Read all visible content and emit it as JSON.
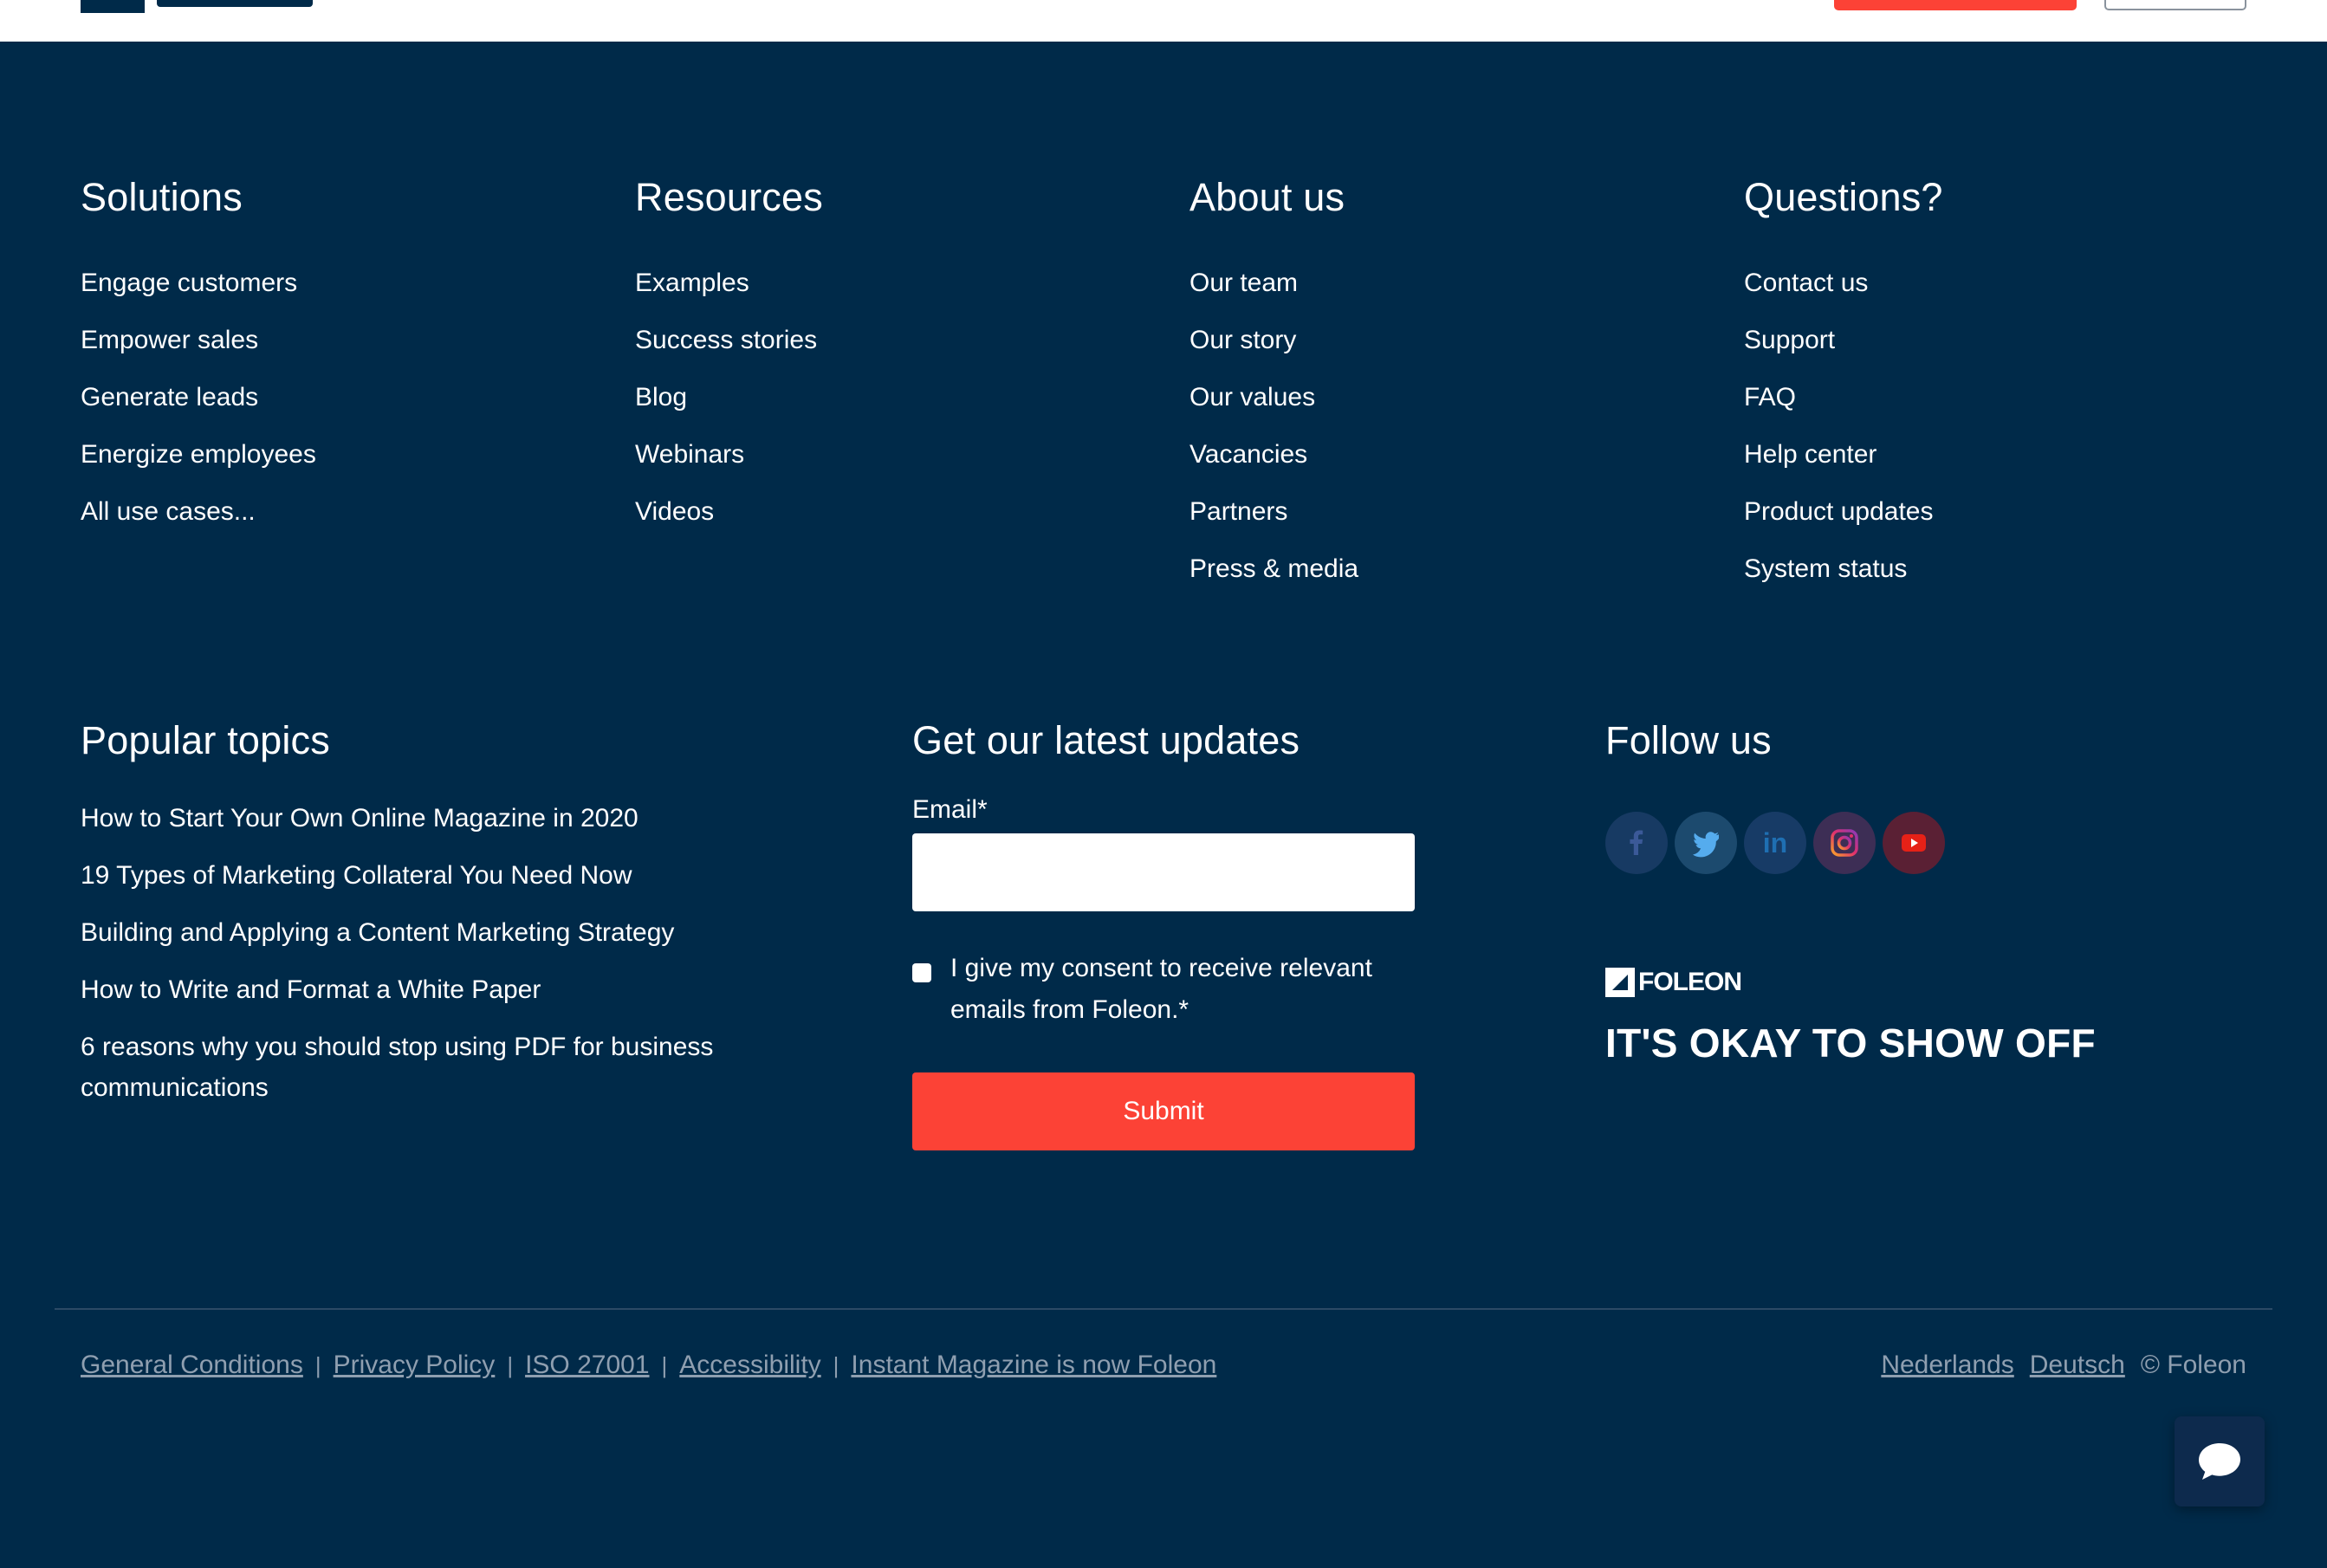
{
  "header": {
    "logo_alt": "Foleon"
  },
  "columns": [
    {
      "title": "Solutions",
      "items": [
        "Engage customers",
        "Empower sales",
        "Generate leads",
        "Energize employees",
        "All use cases..."
      ]
    },
    {
      "title": "Resources",
      "items": [
        "Examples",
        "Success stories",
        "Blog",
        "Webinars",
        "Videos"
      ]
    },
    {
      "title": "About us",
      "items": [
        "Our team",
        "Our story",
        "Our values",
        "Vacancies",
        "Partners",
        "Press & media"
      ]
    },
    {
      "title": "Questions?",
      "items": [
        "Contact us",
        "Support",
        "FAQ",
        "Help center",
        "Product updates",
        "System status"
      ]
    }
  ],
  "popular_topics": {
    "title": "Popular topics",
    "items": [
      "How to Start Your Own Online Magazine in 2020",
      "19 Types of Marketing Collateral You Need Now",
      "Building and Applying a Content Marketing Strategy",
      "How to Write and Format a White Paper",
      "6 reasons why you should stop using PDF for business communications"
    ]
  },
  "newsletter": {
    "title": "Get our latest updates",
    "email_label": "Email*",
    "email_value": "",
    "consent_text": "I give my consent to receive relevant emails from Foleon.*",
    "submit_label": "Submit"
  },
  "follow": {
    "title": "Follow us",
    "icons": [
      "facebook-icon",
      "twitter-icon",
      "linkedin-icon",
      "instagram-icon",
      "youtube-icon"
    ],
    "brand_name": "FOLEON",
    "tagline": "IT'S OKAY TO SHOW OFF"
  },
  "footer": {
    "legal_links": [
      "General Conditions",
      "Privacy Policy",
      "ISO 27001",
      "Accessibility",
      "Instant Magazine is now Foleon"
    ],
    "separator": "|",
    "languages": [
      "Nederlands",
      "Deutsch"
    ],
    "copyright": "© Foleon"
  },
  "colors": {
    "background": "#002a49",
    "accent": "#fc4236",
    "text": "#ffffff",
    "muted": "#8f9fb0"
  }
}
